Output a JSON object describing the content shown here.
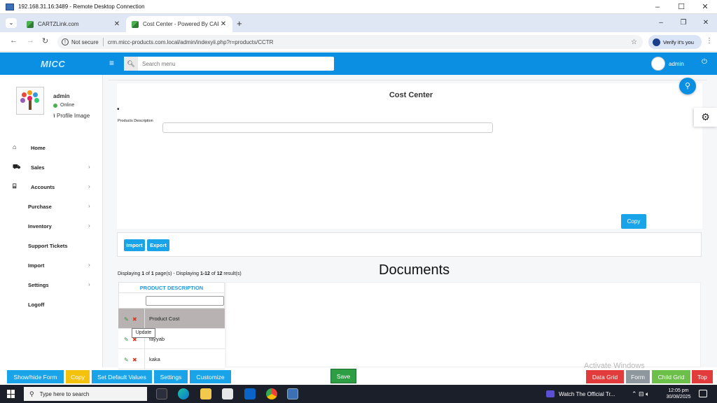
{
  "rdp": {
    "title": "192.168.31.16:3489 - Remote Desktop Connection"
  },
  "browser": {
    "tabs": [
      {
        "label": "CARTZLink.com"
      },
      {
        "label": "Cost Center - Powered By CARTZ"
      }
    ],
    "not_secure": "Not secure",
    "url": "crm.micc-products.com.local/admin/indexyii.php?r=products/CCTR",
    "verify_label": "Verify it's you"
  },
  "header": {
    "logo": "MICC",
    "search_placeholder": "Search menu",
    "user": "admin"
  },
  "sidebar": {
    "user_name": "admin",
    "status": "Online",
    "profile_link": "Profile Image",
    "items": [
      {
        "label": "Home",
        "icon": "home-icon",
        "chevron": false
      },
      {
        "label": "Sales",
        "icon": "cart-icon",
        "chevron": true
      },
      {
        "label": "Accounts",
        "icon": "bank-icon",
        "chevron": true
      },
      {
        "label": "Purchase",
        "chevron": true
      },
      {
        "label": "Inventory",
        "chevron": true
      },
      {
        "label": "Support Tickets",
        "chevron": false
      },
      {
        "label": "Import",
        "chevron": true
      },
      {
        "label": "Settings",
        "chevron": true
      },
      {
        "label": "Logoff",
        "chevron": false
      }
    ]
  },
  "form": {
    "title": "Cost Center",
    "field_label": "Products Description",
    "copy_label": "Copy",
    "import_label": "Import",
    "export_label": "Export"
  },
  "grid": {
    "display_info_parts": [
      "Displaying ",
      "1",
      " of ",
      "1",
      " page(s)  -  Displaying ",
      "1-12",
      " of ",
      "12",
      " result(s)"
    ],
    "docs_title": "Documents",
    "column_header": "PRODUCT DESCRIPTION",
    "rows": [
      "Product Cost",
      "fayyab",
      "kaka"
    ],
    "tooltip": "Update"
  },
  "toolbar": {
    "show_hide_form": "Show/hide Form",
    "copy": "Copy",
    "set_default_values": "Set Default Values",
    "settings": "Settings",
    "customize": "Customize",
    "save": "Save",
    "data_grid": "Data Grid",
    "form": "Form",
    "child_grid": "Child Grid",
    "top": "Top"
  },
  "watermark": "Activate Windows",
  "taskbar": {
    "search_placeholder": "Type here to search",
    "media_title": "Watch The Official Tr...",
    "time": "12:05 pm",
    "date": "30/08/2025"
  },
  "colors": {
    "primary": "#0a8fe3",
    "button_blue": "#19a3e8",
    "copy_yellow": "#f4c20d",
    "save_green": "#2e9e45",
    "danger_red": "#e23b3b",
    "gray": "#8e969e",
    "child_green": "#6cc04a"
  }
}
